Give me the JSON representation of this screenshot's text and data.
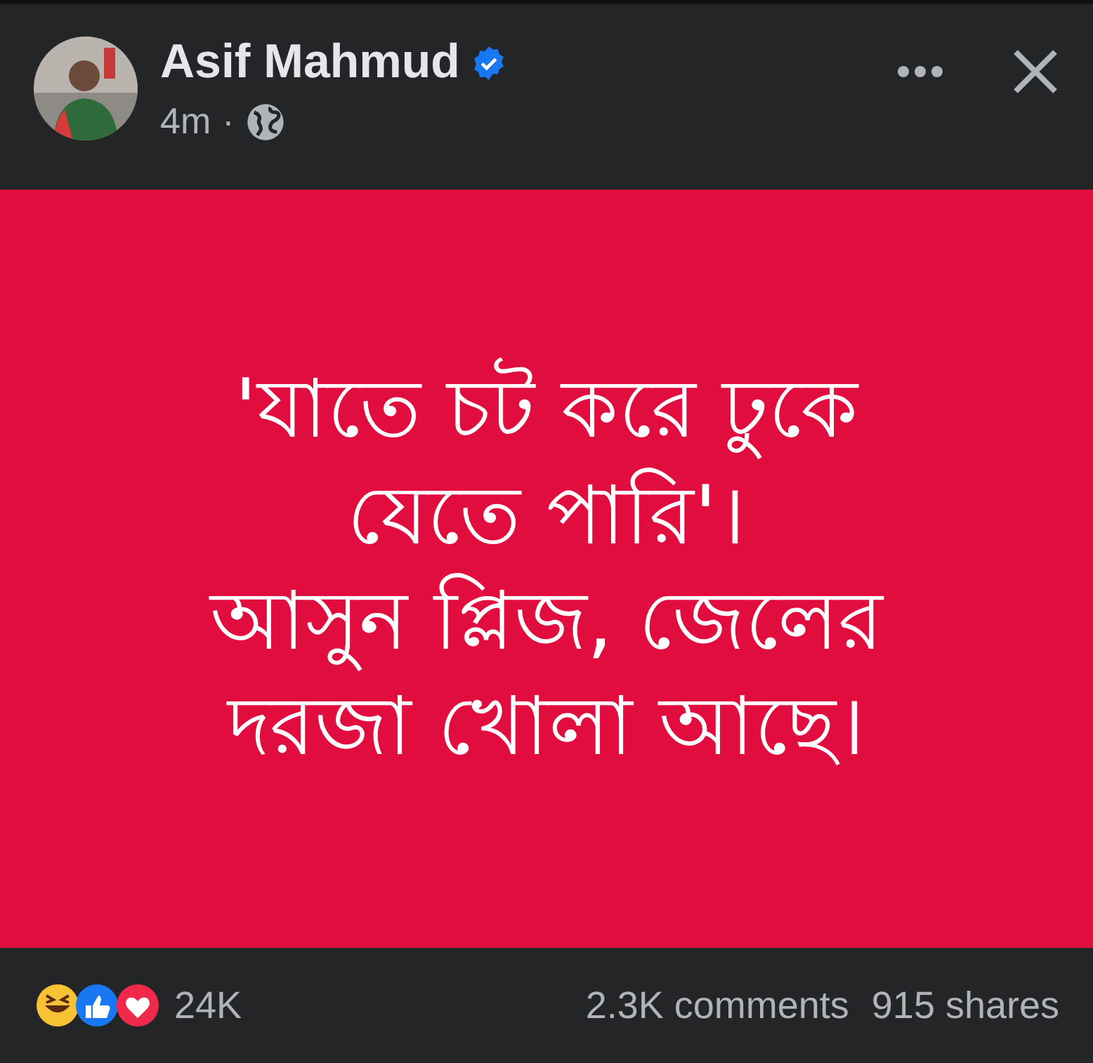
{
  "post": {
    "author": "Asif Mahmud",
    "time": "4m",
    "separator": "·"
  },
  "content": {
    "lines": [
      "'যাতে চট করে ঢুকে",
      "যেতে পারি'।",
      "আসুন প্লিজ, জেলের",
      "দরজা খোলা আছে।"
    ]
  },
  "footer": {
    "reaction_count": "24K",
    "comments": "2.3K comments",
    "shares": "915 shares"
  }
}
